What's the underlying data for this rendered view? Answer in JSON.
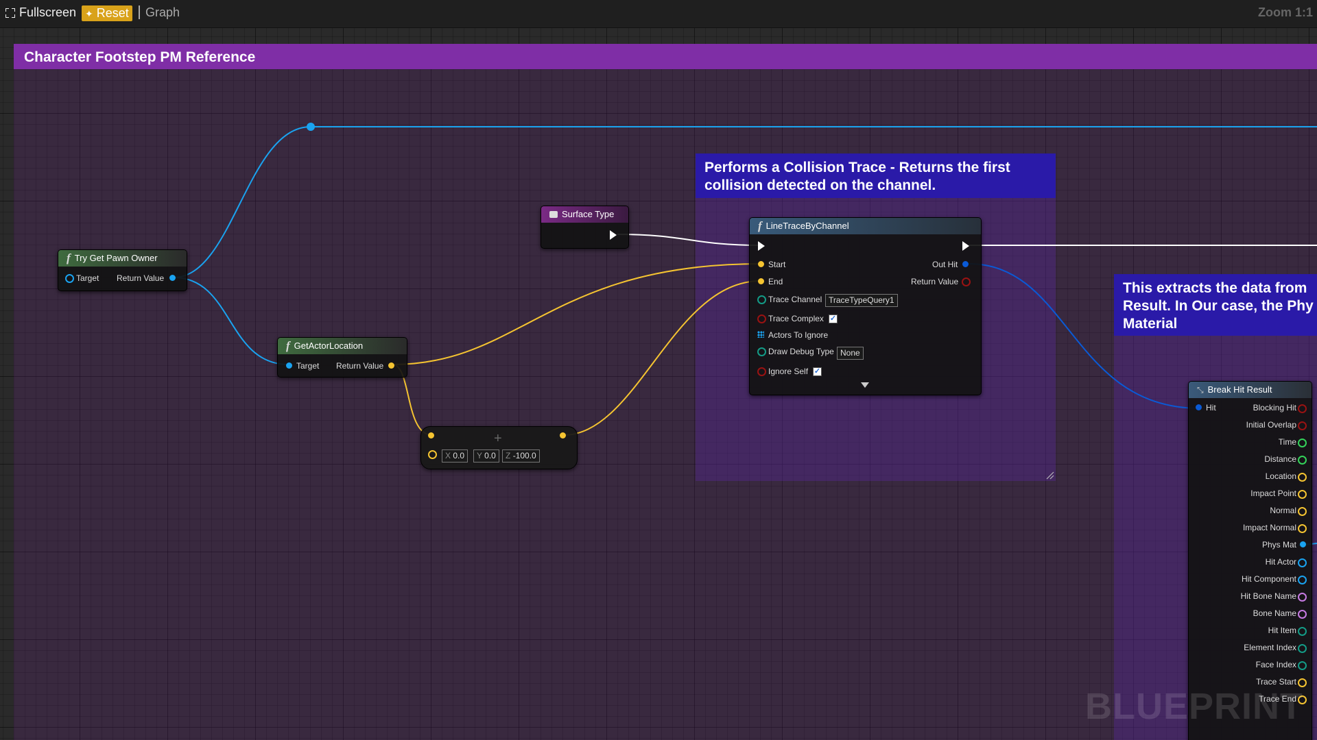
{
  "toolbar": {
    "fullscreen_label": "Fullscreen",
    "reset_label": "Reset",
    "graph_label": "Graph",
    "zoom_label": "Zoom 1:1"
  },
  "comments": {
    "main_title": "Character Footstep PM Reference",
    "trace_text": "Performs a Collision Trace - Returns the first collision detected on the channel.",
    "break_text": "This extracts the data from Result. In Our case, the Phy Material"
  },
  "nodes": {
    "try_get_pawn_owner": {
      "title": "Try Get Pawn Owner",
      "target": "Target",
      "return_value": "Return Value"
    },
    "get_actor_location": {
      "title": "GetActorLocation",
      "target": "Target",
      "return_value": "Return Value"
    },
    "surface_type": {
      "title": "Surface Type"
    },
    "make_vector": {
      "x_label": "X",
      "x_value": "0.0",
      "y_label": "Y",
      "y_value": "0.0",
      "z_label": "Z",
      "z_value": "-100.0"
    },
    "line_trace": {
      "title": "LineTraceByChannel",
      "start": "Start",
      "end": "End",
      "trace_channel": "Trace Channel",
      "trace_channel_value": "TraceTypeQuery1",
      "trace_complex": "Trace Complex",
      "actors_to_ignore": "Actors To Ignore",
      "draw_debug_type": "Draw Debug Type",
      "draw_debug_value": "None",
      "ignore_self": "Ignore Self",
      "out_hit": "Out Hit",
      "return_value": "Return Value"
    },
    "break_hit_result": {
      "title": "Break Hit Result",
      "hit": "Hit",
      "outputs": [
        "Blocking Hit",
        "Initial Overlap",
        "Time",
        "Distance",
        "Location",
        "Impact Point",
        "Normal",
        "Impact Normal",
        "Phys Mat",
        "Hit Actor",
        "Hit Component",
        "Hit Bone Name",
        "Bone Name",
        "Hit Item",
        "Element Index",
        "Face Index",
        "Trace Start",
        "Trace End"
      ]
    }
  },
  "watermark": "BLUEPRINT",
  "colors": {
    "exec": "#ffffff",
    "vector": "#f5c431",
    "object": "#1aa3f0",
    "struct": "#0a5ad6",
    "bool": "#9a1212",
    "float": "#34d35a",
    "name": "#c77be3",
    "byte": "#139c87"
  }
}
